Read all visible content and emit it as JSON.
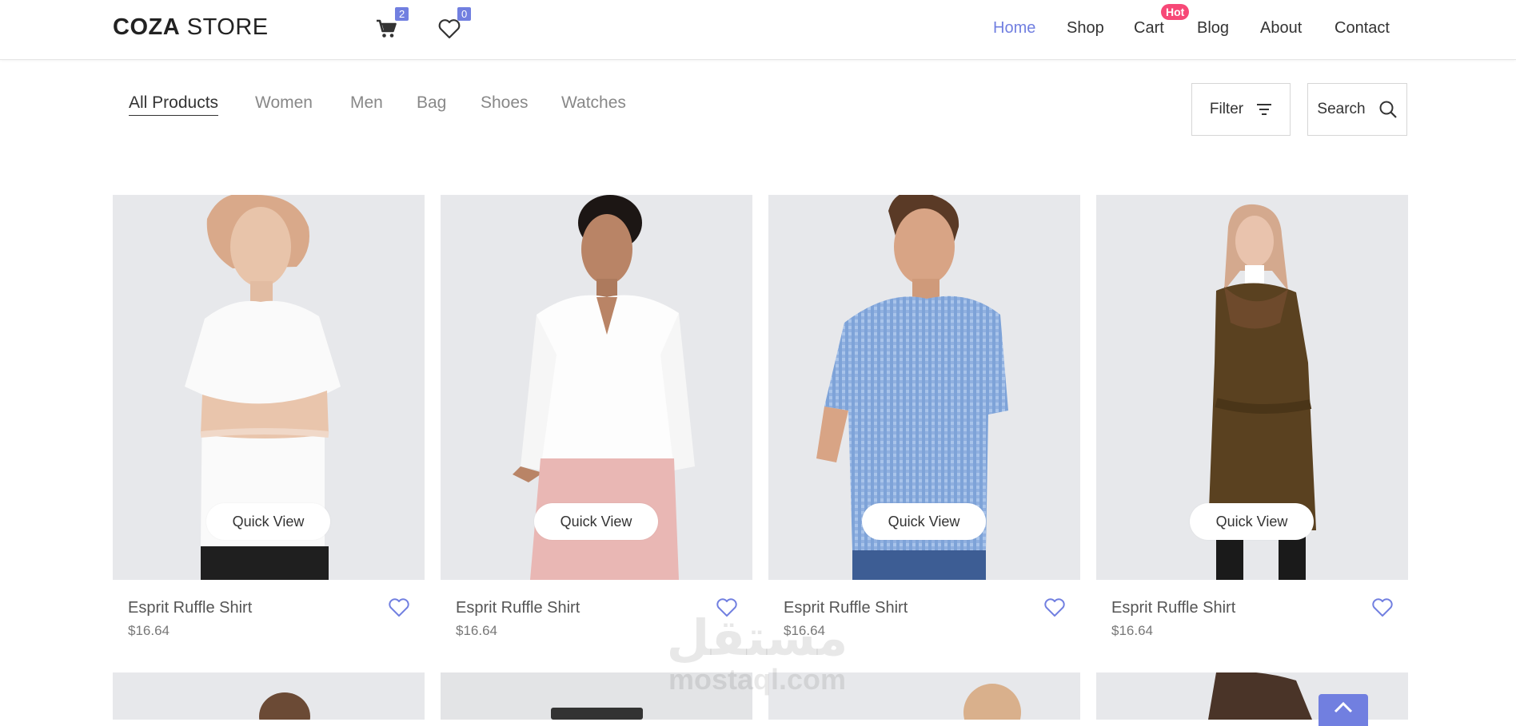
{
  "header": {
    "logo_bold": "COZA",
    "logo_rest": " STORE",
    "cart_count": "2",
    "wishlist_count": "0",
    "nav": [
      {
        "label": "Home",
        "active": true
      },
      {
        "label": "Shop",
        "active": false
      },
      {
        "label": "Cart",
        "active": false,
        "badge": "Hot"
      },
      {
        "label": "Blog",
        "active": false
      },
      {
        "label": "About",
        "active": false
      },
      {
        "label": "Contact",
        "active": false
      }
    ]
  },
  "filters": {
    "categories": [
      "All Products",
      "Women",
      "Men",
      "Bag",
      "Shoes",
      "Watches"
    ],
    "active_category": "All Products",
    "filter_label": "Filter",
    "search_label": "Search"
  },
  "products": [
    {
      "name": "Esprit Ruffle Shirt",
      "price": "$16.64",
      "quick_view": "Quick View"
    },
    {
      "name": "Esprit Ruffle Shirt",
      "price": "$16.64",
      "quick_view": "Quick View"
    },
    {
      "name": "Esprit Ruffle Shirt",
      "price": "$16.64",
      "quick_view": "Quick View"
    },
    {
      "name": "Esprit Ruffle Shirt",
      "price": "$16.64",
      "quick_view": "Quick View"
    }
  ],
  "watermark": {
    "arabic": "مستقل",
    "latin": "mostaql.com"
  },
  "colors": {
    "accent": "#717fe0",
    "hot": "#f74877",
    "text": "#333333",
    "muted": "#888888"
  }
}
